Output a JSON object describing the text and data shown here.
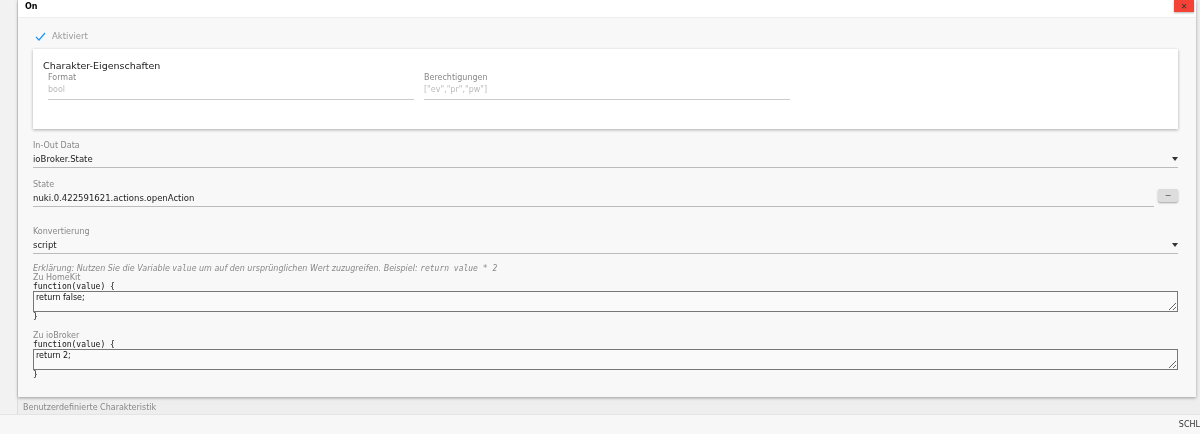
{
  "dialog": {
    "title": "On",
    "close": "✕"
  },
  "enabled": {
    "label": "Aktiviert",
    "checked": true
  },
  "card": {
    "title": "Charakter-Eigenschaften",
    "fields": [
      {
        "label": "Format",
        "placeholder": "bool"
      },
      {
        "label": "Berechtigungen",
        "placeholder": "[\"ev\",\"pr\",\"pw\"]"
      }
    ]
  },
  "in_out": {
    "label": "In-Out Data",
    "value": "ioBroker.State"
  },
  "state": {
    "label": "State",
    "value": "nuki.0.422591621.actions.openAction",
    "button": "−"
  },
  "conversion": {
    "label": "Konvertierung",
    "value": "script"
  },
  "explanation": [
    {
      "kind": "text",
      "text": "Erklärung: Nutzen Sie die Variable "
    },
    {
      "kind": "code",
      "text": "value"
    },
    {
      "kind": "text",
      "text": " um auf den ursprünglichen Wert zuzugreifen. Beispiel: "
    },
    {
      "kind": "code",
      "text": "return value * 2"
    }
  ],
  "scripts": [
    {
      "label": "Zu HomeKit",
      "head": "function(value) {",
      "value": "return false;",
      "tail": "}"
    },
    {
      "label": "Zu ioBroker",
      "head": "function(value) {",
      "value": "return 2;",
      "tail": "}"
    }
  ],
  "custom_characteristic": "Benutzerdefinierte Charakteristik",
  "footer_button": "SCHL"
}
